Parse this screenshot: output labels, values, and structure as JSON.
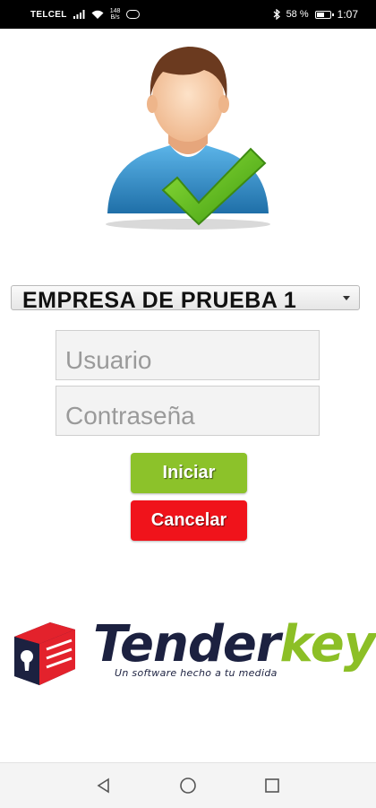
{
  "status_bar": {
    "carrier": "TELCEL",
    "speed_value": "148",
    "speed_unit": "B/s",
    "battery_text": "58 %",
    "battery_level": 0.58,
    "time": "1:07"
  },
  "avatar": {
    "icon": "user-check-icon",
    "colors": {
      "skin": "#f7c9a2",
      "hair": "#6b3a1f",
      "shirt": "#3b9ad6",
      "check": "#6cbf1e"
    }
  },
  "company_select": {
    "value": "EMPRESA DE PRUEBA 1"
  },
  "login": {
    "username_placeholder": "Usuario",
    "password_placeholder": "Contraseña"
  },
  "buttons": {
    "start_label": "Iniciar",
    "cancel_label": "Cancelar"
  },
  "logo": {
    "word_part1": "Tender",
    "word_part2": "key",
    "tagline": "Un software hecho a tu medida",
    "colors": {
      "navy": "#1c2140",
      "green": "#8cbf26",
      "red": "#e3222c"
    }
  },
  "nav_bar": {
    "icons": [
      "back-icon",
      "home-icon",
      "recents-icon"
    ]
  }
}
